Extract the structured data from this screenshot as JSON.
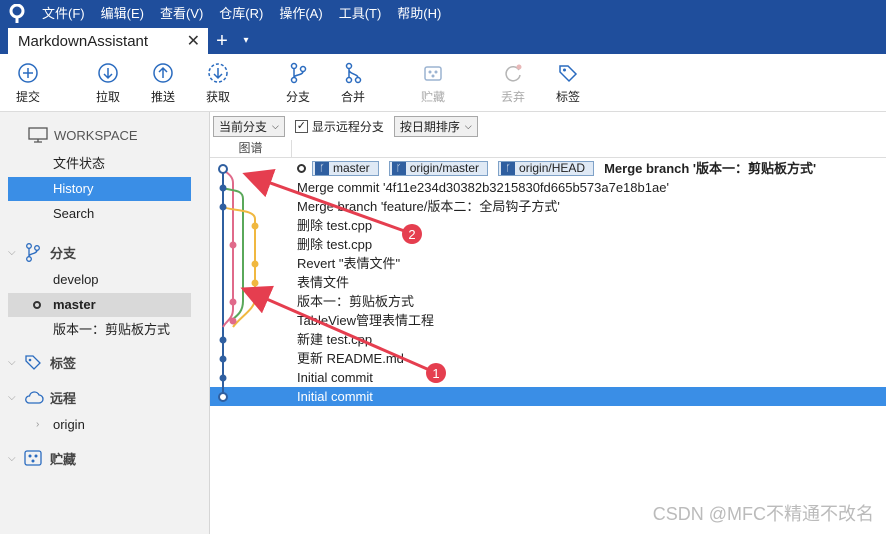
{
  "menu": [
    "文件(F)",
    "编辑(E)",
    "查看(V)",
    "仓库(R)",
    "操作(A)",
    "工具(T)",
    "帮助(H)"
  ],
  "tab": {
    "title": "MarkdownAssistant",
    "close": "✕",
    "add": "+",
    "dropdown": "▾"
  },
  "toolbar": {
    "commit": "提交",
    "pull": "拉取",
    "push": "推送",
    "fetch": "获取",
    "branch": "分支",
    "merge": "合并",
    "stash": "贮藏",
    "discard": "丢弃",
    "tag": "标签"
  },
  "sidebar": {
    "workspace": "WORKSPACE",
    "workspace_items": [
      "文件状态",
      "History",
      "Search"
    ],
    "branches_header": "分支",
    "branches": [
      "develop",
      "master",
      "版本一：剪贴板方式"
    ],
    "tags_header": "标签",
    "remotes_header": "远程",
    "remotes": [
      "origin"
    ],
    "stash_header": "贮藏"
  },
  "filters": {
    "branch_combo": "当前分支",
    "show_remote": "显示远程分支",
    "sort_combo": "按日期排序"
  },
  "columns": {
    "graph": "图谱"
  },
  "head_refs": [
    "master",
    "origin/master",
    "origin/HEAD"
  ],
  "commits": [
    "Merge branch '版本一：剪贴板方式'",
    "Merge commit '4f11e234d30382b3215830fd665b573a7e18b1ae'",
    "Merge branch 'feature/版本二：全局钩子方式'",
    "删除 test.cpp",
    "删除 test.cpp",
    "Revert \"表情文件\"",
    "表情文件",
    "版本一：剪贴板方式",
    "TableView管理表情工程",
    "新建 test.cpp",
    "更新 README.md",
    "Initial commit",
    "Initial commit"
  ],
  "annotations": [
    "1",
    "2"
  ],
  "watermark": "CSDN @MFC不精通不改名",
  "colors": {
    "menubar": "#1f4e9c",
    "selection": "#3a8ee6",
    "arrow": "#e53e4f"
  }
}
